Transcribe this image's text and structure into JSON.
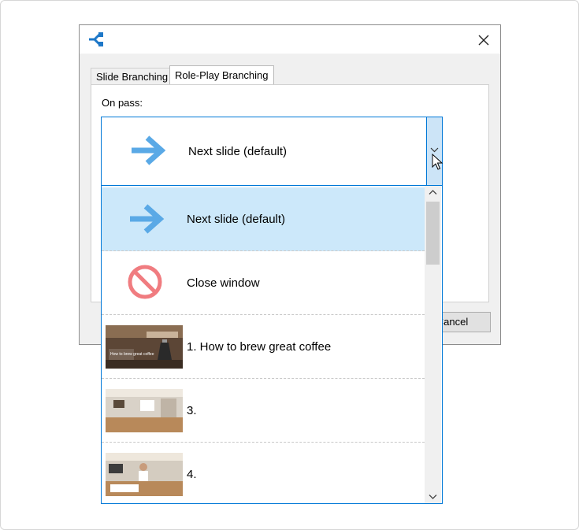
{
  "dialog": {
    "app_icon": "branching-icon",
    "close_icon": "close-icon",
    "tabs": [
      {
        "label": "Slide Branching"
      },
      {
        "label": "Role-Play Branching"
      }
    ],
    "cancel_label": "Cancel"
  },
  "panel": {
    "on_pass_label": "On pass:",
    "combo": {
      "selected_value": "Next slide (default)",
      "icon": "right-arrow-icon"
    }
  },
  "dropdown": {
    "items": [
      {
        "label": "Next slide (default)",
        "icon": "right-arrow-icon",
        "selected": true
      },
      {
        "label": "Close window",
        "icon": "prohibited-icon",
        "selected": false
      },
      {
        "label": "1. How to brew great coffee",
        "thumbnail_caption": "How to brew great coffee",
        "selected": false
      },
      {
        "label": "3.",
        "selected": false
      },
      {
        "label": "4.",
        "selected": false
      }
    ]
  },
  "colors": {
    "accent": "#0078d7",
    "selection": "#cce8fa",
    "arrow": "#5aa9e6",
    "prohibited": "#f07c80"
  }
}
